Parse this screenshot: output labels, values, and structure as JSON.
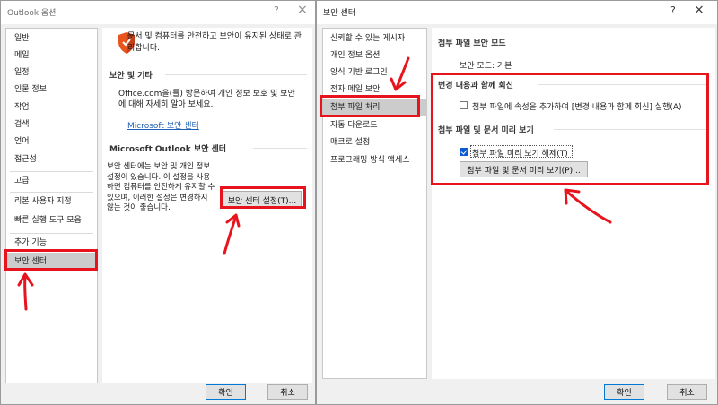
{
  "outlook_options": {
    "title": "Outlook 옵션",
    "help_glyph": "?",
    "close_glyph": "×",
    "nav": [
      {
        "label": "일반"
      },
      {
        "label": "메일"
      },
      {
        "label": "일정"
      },
      {
        "label": "인물 정보"
      },
      {
        "label": "작업"
      },
      {
        "label": "검색"
      },
      {
        "label": "언어"
      },
      {
        "label": "접근성"
      },
      {
        "label": "고급"
      },
      {
        "label": "리본 사용자 지정"
      },
      {
        "label": "빠른 실행 도구 모음"
      },
      {
        "label": "추가 기능"
      },
      {
        "label": "보안 센터",
        "selected": true
      }
    ],
    "intro": "문서 및 컴퓨터를 안전하고 보안이 유지된 상태로 관리합니다.",
    "section_security_other": "보안 및 기타",
    "office_privacy_text": "Office.com을(를) 방문하여 개인 정보 보호 및 보안에 대해 자세히 알아 보세요.",
    "ms_trust_link": "Microsoft 보안 센터",
    "section_trust_center": "Microsoft Outlook 보안 센터",
    "trust_description": "보안 센터에는 보안 및 개인 정보 설정이 있습니다. 이 설정을 사용하면 컴퓨터를 안전하게 유지할 수 있으며, 이러한 설정은 변경하지 않는 것이 좋습니다.",
    "trust_settings_button": "보안 센터 설정(T)...",
    "ok_button": "확인",
    "cancel_button": "취소"
  },
  "trust_center": {
    "title": "보안 센터",
    "help_glyph": "?",
    "close_glyph": "×",
    "nav": [
      {
        "label": "신뢰할 수 있는 게시자"
      },
      {
        "label": "개인 정보 옵션"
      },
      {
        "label": "양식 기반 로그인"
      },
      {
        "label": "전자 메일 보안"
      },
      {
        "label": "첨부 파일 처리",
        "selected": true
      },
      {
        "label": "자동 다운로드"
      },
      {
        "label": "매크로 설정"
      },
      {
        "label": "프로그래밍 방식 액세스"
      }
    ],
    "section_attachment_security": "첨부 파일 보안 모드",
    "security_mode_text": "보안 모드: 기본",
    "section_reply_changes": "변경 내용과 함께 회신",
    "reply_checkbox_label": "첨부 파일에 속성을 추가하여 [변경 내용과 함께 회신] 실행(A)",
    "reply_checkbox_checked": false,
    "section_preview": "첨부 파일 및 문서 미리 보기",
    "preview_off_label": "첨부 파일 미리 보기 해제(T)",
    "preview_off_checked": true,
    "preview_button": "첨부 파일 및 문서 미리 보기(P)...",
    "ok_button": "확인",
    "cancel_button": "취소"
  },
  "annotation_color": "#e8141d"
}
